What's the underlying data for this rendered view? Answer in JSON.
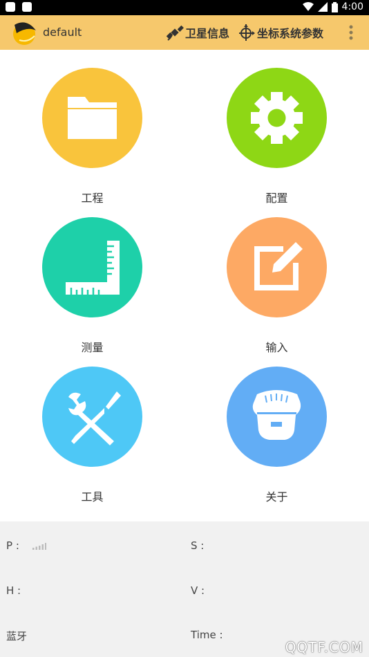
{
  "status_bar": {
    "time": "4:00",
    "icons": [
      "cn-icon",
      "a-icon",
      "wifi-icon",
      "signal-icon",
      "battery-icon"
    ]
  },
  "app_bar": {
    "project_name": "default",
    "satellite_label": "卫星信息",
    "coord_label": "坐标系统参数",
    "background_color": "#f6c86c"
  },
  "menu": [
    {
      "label": "工程",
      "icon": "folder-icon",
      "color": "#f9c43c"
    },
    {
      "label": "配置",
      "icon": "gear-icon",
      "color": "#8ed715"
    },
    {
      "label": "测量",
      "icon": "ruler-icon",
      "color": "#1ed0a9"
    },
    {
      "label": "输入",
      "icon": "edit-icon",
      "color": "#fda964"
    },
    {
      "label": "工具",
      "icon": "tools-icon",
      "color": "#4ec8f6"
    },
    {
      "label": "关于",
      "icon": "receiver-icon",
      "color": "#62adf5"
    }
  ],
  "footer": {
    "p_label": "P :",
    "s_label": "S :",
    "h_label": "H :",
    "v_label": "V :",
    "bt_label": "蓝牙",
    "time_label": "Time :"
  },
  "watermark": "QQTF.COM"
}
